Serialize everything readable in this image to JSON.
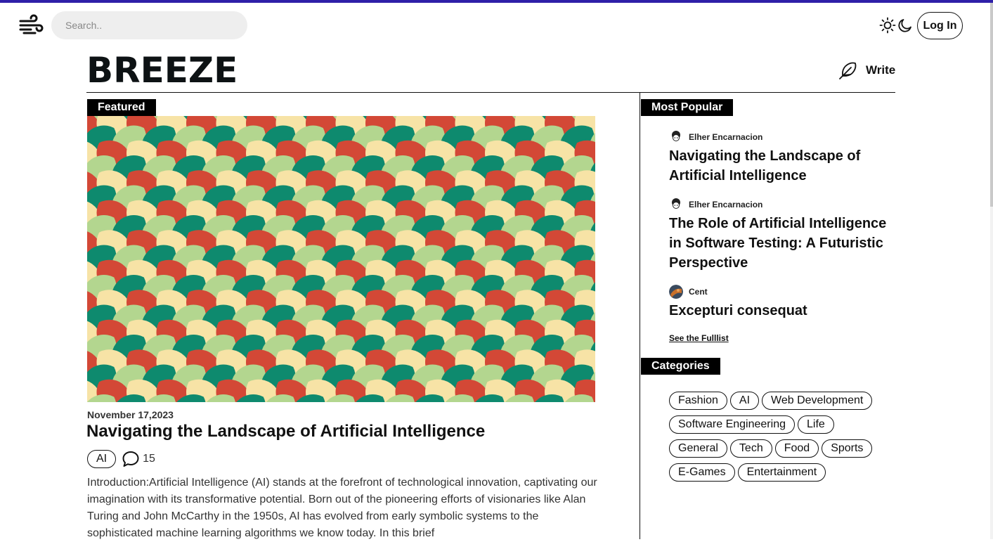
{
  "header": {
    "search_placeholder": "Search..",
    "login_label": "Log In",
    "brand": "BREEZE",
    "write_label": "Write"
  },
  "featured": {
    "label": "Featured",
    "date": "November 17,2023",
    "title": "Navigating the Landscape of Artificial Intelligence",
    "tag": "AI",
    "comment_count": "15",
    "excerpt": "Introduction:Artificial Intelligence (AI) stands at the forefront of technological innovation, captivating our imagination with its transformative potential. Born out of the pioneering efforts of visionaries like Alan Turing and John McCarthy in the 1950s, AI has evolved from early symbolic systems to the sophisticated machine learning algorithms we know today. In this brief",
    "pattern_colors": [
      "#1b2233",
      "#d34836",
      "#f7e3a6",
      "#0e8a6e",
      "#b3d68f"
    ]
  },
  "popular": {
    "label": "Most Popular",
    "items": [
      {
        "author": "Elher Encarnacion",
        "title": "Navigating the Landscape of Artificial Intelligence"
      },
      {
        "author": "Elher Encarnacion",
        "title": "The Role of Artificial Intelligence in Software Testing: A Futuristic Perspective"
      },
      {
        "author": "Cent",
        "title": "Excepturi consequat"
      }
    ],
    "full_list_label": "See the Fulllist"
  },
  "categories": {
    "label": "Categories",
    "rows": [
      [
        "Fashion",
        "AI",
        "Web Development"
      ],
      [
        "Software Engineering",
        "Life"
      ],
      [
        "General",
        "Tech",
        "Food",
        "Sports"
      ],
      [
        "E-Games",
        "Entertainment"
      ]
    ]
  },
  "colors": {
    "accent_bar": "#2e1fa8",
    "text": "#111111"
  }
}
